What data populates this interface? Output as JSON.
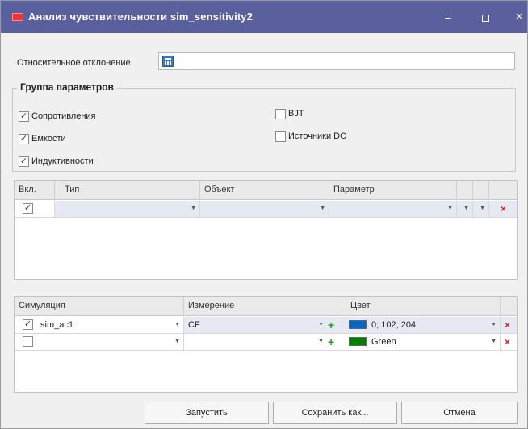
{
  "window": {
    "title": "Анализ чувствительности sim_sensitivity2",
    "minimize": "–",
    "close": "×"
  },
  "relative_deviation": {
    "label": "Относительное отклонение",
    "value": ""
  },
  "param_group": {
    "title": "Группа параметров",
    "items": [
      {
        "label": "Сопротивления",
        "checked": true
      },
      {
        "label": "Емкости",
        "checked": true
      },
      {
        "label": "Индуктивности",
        "checked": true
      },
      {
        "label": "BJT",
        "checked": false
      },
      {
        "label": "Источники DC",
        "checked": false
      }
    ]
  },
  "params_table": {
    "headers": [
      "Вкл.",
      "Тип",
      "Объект",
      "Параметр"
    ],
    "rows": [
      {
        "enabled": true,
        "type": "",
        "object": "",
        "parameter": ""
      }
    ]
  },
  "sim_table": {
    "headers": [
      "Симуляция",
      "Измерение",
      "Цвет"
    ],
    "rows": [
      {
        "enabled": true,
        "simulation": "sim_ac1",
        "measurement": "CF",
        "color_label": "0; 102; 204",
        "color_hex": "#0066cc"
      },
      {
        "enabled": false,
        "simulation": "",
        "measurement": "",
        "color_label": "Green",
        "color_hex": "#008000"
      }
    ]
  },
  "buttons": {
    "run": "Запустить",
    "save_as": "Сохранить как...",
    "cancel": "Отмена"
  },
  "icons": {
    "dropdown": "▼",
    "plus": "+",
    "delete": "×",
    "check": "✓"
  }
}
